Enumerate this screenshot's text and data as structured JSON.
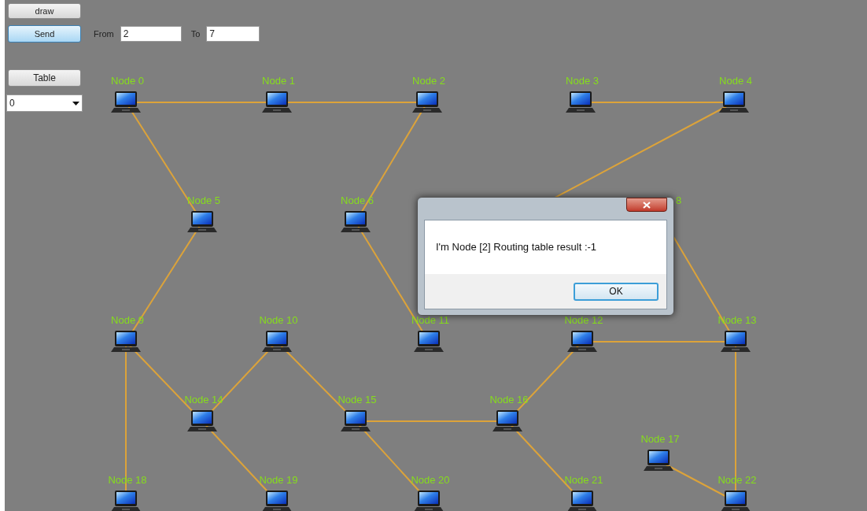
{
  "toolbar": {
    "draw_button": {
      "label": "draw",
      "focused": false
    },
    "send_button": {
      "label": "Send",
      "focused": true
    },
    "from_label": "From",
    "from_value": "2",
    "to_label": "To",
    "to_value": "7",
    "table_button": {
      "label": "Table",
      "focused": false
    },
    "table_select": "0"
  },
  "nodes": [
    {
      "kind": "node",
      "label": "Node 0"
    },
    {
      "kind": "node",
      "label": "Node 1"
    },
    {
      "kind": "node",
      "label": "Node 2"
    },
    {
      "kind": "node",
      "label": "Node 3"
    },
    {
      "kind": "node",
      "label": "Node 4"
    },
    {
      "kind": "node",
      "label": "Node 5"
    },
    {
      "kind": "node",
      "label": "Node 6"
    },
    {
      "kind": "label",
      "label": "8"
    },
    {
      "kind": "node",
      "label": "Node 9"
    },
    {
      "kind": "node",
      "label": "Node 10"
    },
    {
      "kind": "node",
      "label": "Node 11"
    },
    {
      "kind": "node",
      "label": "Node 12"
    },
    {
      "kind": "node",
      "label": "Node 13"
    },
    {
      "kind": "node",
      "label": "Node 14"
    },
    {
      "kind": "node",
      "label": "Node 15"
    },
    {
      "kind": "node",
      "label": "Node 16"
    },
    {
      "kind": "node",
      "label": "Node 17"
    },
    {
      "kind": "node",
      "label": "Node 18"
    },
    {
      "kind": "node",
      "label": "Node 19"
    },
    {
      "kind": "node",
      "label": "Node 20"
    },
    {
      "kind": "node",
      "label": "Node 21"
    },
    {
      "kind": "node",
      "label": "Node 22"
    }
  ],
  "dialog": {
    "message": "I'm Node [2] Routing table result :-1",
    "ok_button": "OK"
  }
}
